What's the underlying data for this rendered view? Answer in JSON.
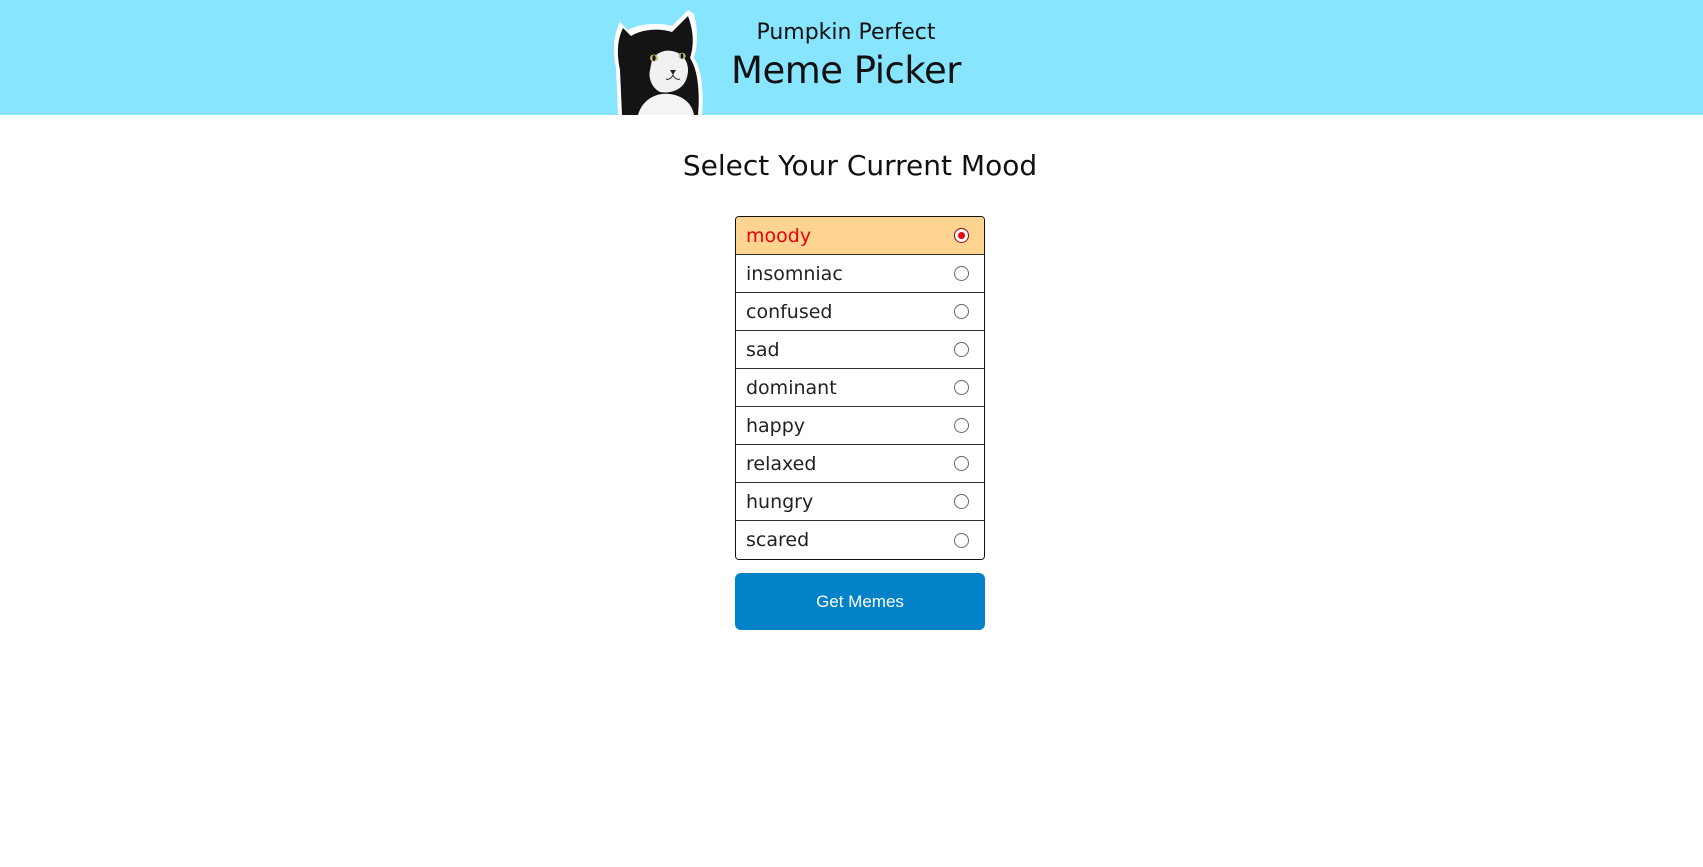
{
  "header": {
    "subtitle": "Pumpkin Perfect",
    "title": "Meme Picker",
    "logo_icon": "cat-logo-icon",
    "background_color": "#87e5ff"
  },
  "main": {
    "heading": "Select Your Current Mood",
    "moods": [
      {
        "label": "moody",
        "selected": true
      },
      {
        "label": "insomniac",
        "selected": false
      },
      {
        "label": "confused",
        "selected": false
      },
      {
        "label": "sad",
        "selected": false
      },
      {
        "label": "dominant",
        "selected": false
      },
      {
        "label": "happy",
        "selected": false
      },
      {
        "label": "relaxed",
        "selected": false
      },
      {
        "label": "hungry",
        "selected": false
      },
      {
        "label": "scared",
        "selected": false
      }
    ],
    "selected_highlight_color": "#ffd490",
    "selected_text_color": "#e8000b",
    "button_label": "Get Memes",
    "button_color": "#0282c8"
  }
}
